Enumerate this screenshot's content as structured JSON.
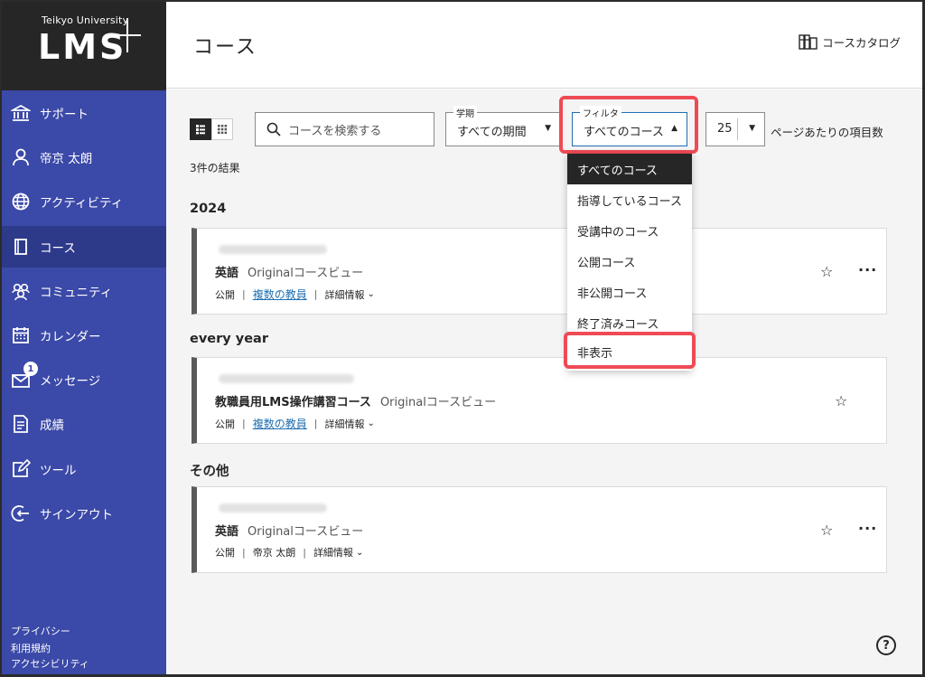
{
  "brand": {
    "university": "Teikyo University",
    "product": "LMS"
  },
  "sidebar": {
    "items": [
      {
        "label": "サポート",
        "icon": "bank-icon"
      },
      {
        "label": "帝京 太朗",
        "icon": "user-icon"
      },
      {
        "label": "アクティビティ",
        "icon": "globe-icon"
      },
      {
        "label": "コース",
        "icon": "course-icon"
      },
      {
        "label": "コミュニティ",
        "icon": "community-icon"
      },
      {
        "label": "カレンダー",
        "icon": "calendar-icon"
      },
      {
        "label": "メッセージ",
        "icon": "envelope-icon",
        "badge": "1"
      },
      {
        "label": "成績",
        "icon": "grades-icon"
      },
      {
        "label": "ツール",
        "icon": "tools-icon"
      },
      {
        "label": "サインアウト",
        "icon": "signout-icon"
      }
    ],
    "footer": [
      "プライバシー",
      "利用規約",
      "アクセシビリティ"
    ]
  },
  "header": {
    "title": "コース",
    "catalog": "コースカタログ"
  },
  "toolbar": {
    "search_placeholder": "コースを検索する",
    "term_legend": "学期",
    "term_value": "すべての期間",
    "filter_legend": "フィルタ",
    "filter_value": "すべてのコース",
    "per_page_value": "25",
    "per_page_label": "ページあたりの項目数"
  },
  "results": "3件の結果",
  "sections": [
    {
      "heading": "2024",
      "course": {
        "name": "英語",
        "type": "Originalコースビュー",
        "status": "公開",
        "instructor": "複数の教員",
        "details": "詳細情報"
      }
    },
    {
      "heading": "every year",
      "course": {
        "name": "教職員用LMS操作講習コース",
        "type": "Originalコースビュー",
        "status": "公開",
        "instructor": "複数の教員",
        "details": "詳細情報"
      }
    },
    {
      "heading": "その他",
      "course": {
        "name": "英語",
        "type": "Originalコースビュー",
        "status": "公開",
        "instructor": "帝京 太朗",
        "details": "詳細情報"
      }
    }
  ],
  "filter_dropdown": {
    "options": [
      "すべてのコース",
      "指導しているコース",
      "受講中のコース",
      "公開コース",
      "非公開コース",
      "終了済みコース",
      "非表示"
    ],
    "selected": "すべてのコース"
  },
  "colors": {
    "sidebar": "#3b49a8",
    "sidebar_active": "#2d3a8a",
    "highlight": "#ee4b55",
    "link": "#1f6fb0"
  }
}
